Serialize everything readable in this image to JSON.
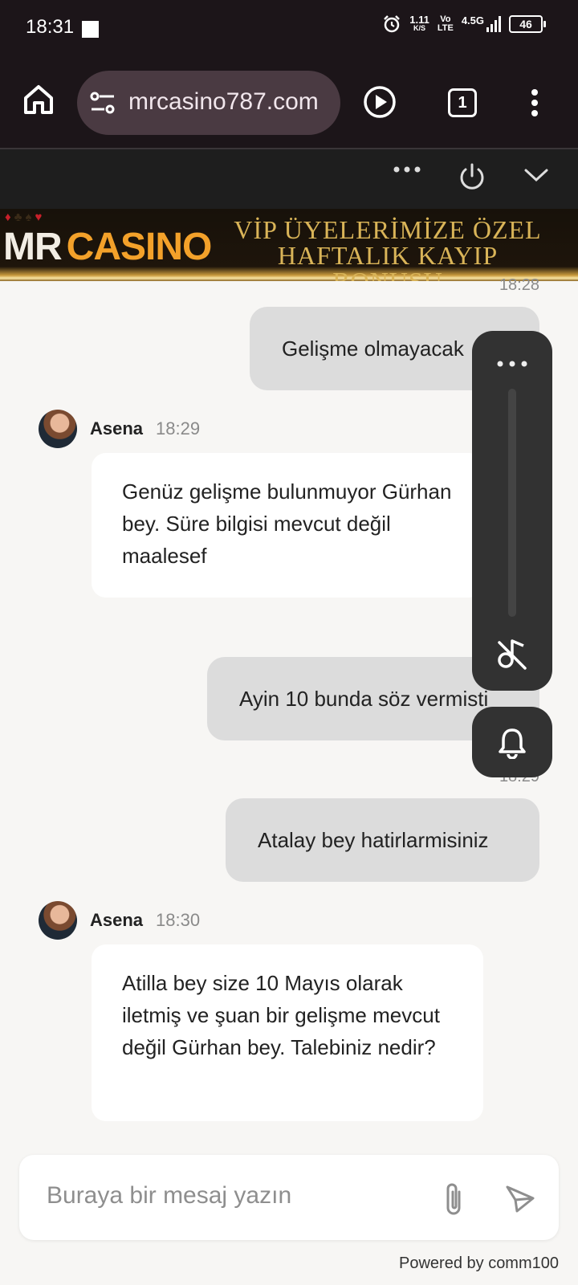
{
  "status_bar": {
    "time": "18:31",
    "net_speed": "1.11",
    "net_speed_unit": "K/S",
    "carrier_top": "Vo",
    "carrier_bottom": "LTE",
    "network": "4.5G",
    "battery": "46"
  },
  "browser": {
    "url": "mrcasino787.com",
    "tab_count": "1",
    "icons": [
      "home-icon",
      "site-settings-icon",
      "play-icon",
      "tab-switcher-icon",
      "more-vert-icon"
    ]
  },
  "chat_header": {
    "icons": [
      "more-horiz-icon",
      "power-icon",
      "chevron-down-icon"
    ]
  },
  "banner": {
    "logo_mr": "MR",
    "logo_casino": "CASINO",
    "line1": "VİP ÜYELERİMİZE ÖZEL",
    "line2": "HAFTALIK KAYIP BONUSU"
  },
  "messages": [
    {
      "type": "timestamp",
      "text": "18:28"
    },
    {
      "type": "outgoing",
      "text": "Gelişme olmayacak"
    },
    {
      "type": "incoming",
      "sender": "Asena",
      "time": "18:29",
      "text": "Genüz gelişme bulunmuyor Gürhan bey. Süre bilgisi mevcut değil maalesef"
    },
    {
      "type": "outgoing",
      "text": "Ayin 10 bunda söz vermisti"
    },
    {
      "type": "timestamp",
      "text": "18:29"
    },
    {
      "type": "outgoing",
      "text": "Atalay bey hatirlarmisiniz"
    },
    {
      "type": "incoming",
      "sender": "Asena",
      "time": "18:30",
      "text": "Atilla bey size 10 Mayıs olarak iletmiş ve şuan bir gelişme mevcut değil Gürhan bey. Talebiniz nedir?"
    }
  ],
  "composer": {
    "placeholder": "Buraya bir mesaj yazın",
    "icons": [
      "attach-icon",
      "send-icon"
    ]
  },
  "footer": {
    "powered_by": "Powered by comm100"
  },
  "colors": {
    "browser_chrome": "#1c1519",
    "url_pill": "#4a3a42",
    "chat_header": "#1e1e1e",
    "chat_bg": "#f7f6f4",
    "outgoing_bubble": "#dcdcdc",
    "incoming_bubble": "#ffffff",
    "banner_gold": "#d9b458",
    "logo_orange": "#f3a12a"
  }
}
